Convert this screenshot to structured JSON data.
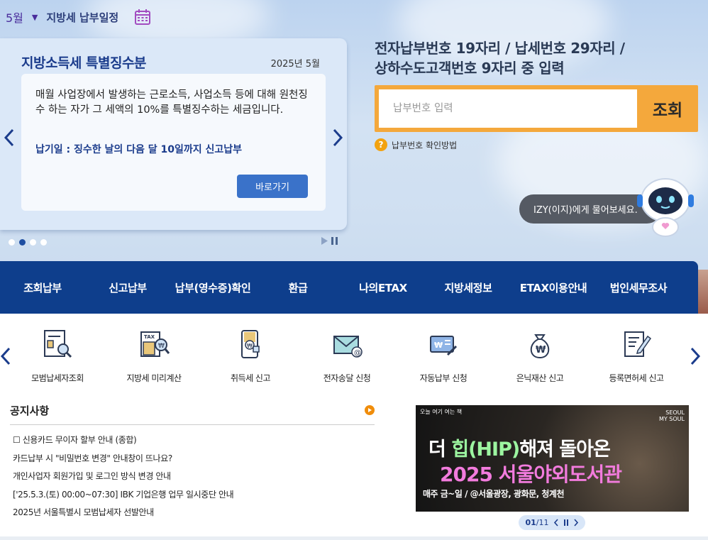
{
  "schedule": {
    "month": "5월",
    "title": "지방세 납부일정",
    "calendar_icon": "calendar-icon"
  },
  "notice_card": {
    "title": "지방소득세 특별징수분",
    "date": "2025년 5월",
    "description": "매월 사업장에서 발생하는 근로소득, 사업소득 등에 대해 원천징수 하는 자가 그 세액의 10%를 특별징수하는 세금입니다.",
    "due": "납기일 : 징수한 날의 다음 달 10일까지 신고납부",
    "button": "바로가기",
    "slide_count": 4,
    "active_slide": 2
  },
  "search": {
    "headline_line1": "전자납부번호 19자리 / 납세번호 29자리 /",
    "headline_line2": "상하수도고객번호 9자리 중 입력",
    "placeholder": "납부번호 입력",
    "value": "",
    "button": "조회",
    "help_icon": "?",
    "help_text": "납부번호 확인방법"
  },
  "chatbot": {
    "bubble": "IZY(이지)에게 물어보세요."
  },
  "main_nav": [
    "조회납부",
    "신고납부",
    "납부(영수증)확인",
    "환급",
    "나의ETAX",
    "지방세정보",
    "ETAX이용안내",
    "법인세무조사"
  ],
  "quick_services": [
    {
      "label": "모범납세자조회",
      "icon": "certificate-search-icon"
    },
    {
      "label": "지방세 미리계산",
      "icon": "tax-calculator-icon"
    },
    {
      "label": "취득세 신고",
      "icon": "wallet-won-icon"
    },
    {
      "label": "전자송달 신청",
      "icon": "email-at-icon"
    },
    {
      "label": "자동납부 신청",
      "icon": "card-auto-pay-icon"
    },
    {
      "label": "은닉재산 신고",
      "icon": "money-bag-icon"
    },
    {
      "label": "등록면허세 신고",
      "icon": "document-pen-icon"
    }
  ],
  "notices": {
    "title": "공지사항",
    "items": [
      "☐ 신용카드 무이자 할부 안내 (종합)",
      "카드납부 시 \"비밀번호 변경\" 안내창이 뜨나요?",
      "개인사업자 회원가입 및 로그인 방식 변경 안내",
      "['25.5.3.(토) 00:00~07:30] IBK 기업은행 업무 일시중단 안내",
      "2025년 서울특별시 모범납세자 선발안내"
    ]
  },
  "banner": {
    "line1_prefix": "더 ",
    "line1_highlight": "힙(HIP)",
    "line1_suffix": "해져 돌아온",
    "line2": "2025 서울야외도서관",
    "line3": "매주 금~일 / @서울광장, 광화문, 청계천",
    "tag_left": "오늘 여기 여는 책",
    "tag_right_1": "SEOUL",
    "tag_right_2": "MY SOUL",
    "page_current": "01",
    "page_total": "/11"
  },
  "colors": {
    "nav": "#0e3e8c",
    "search_accent": "#f4a83c",
    "button_blue": "#3a72c9",
    "notice_dot": "#f08d0b"
  }
}
